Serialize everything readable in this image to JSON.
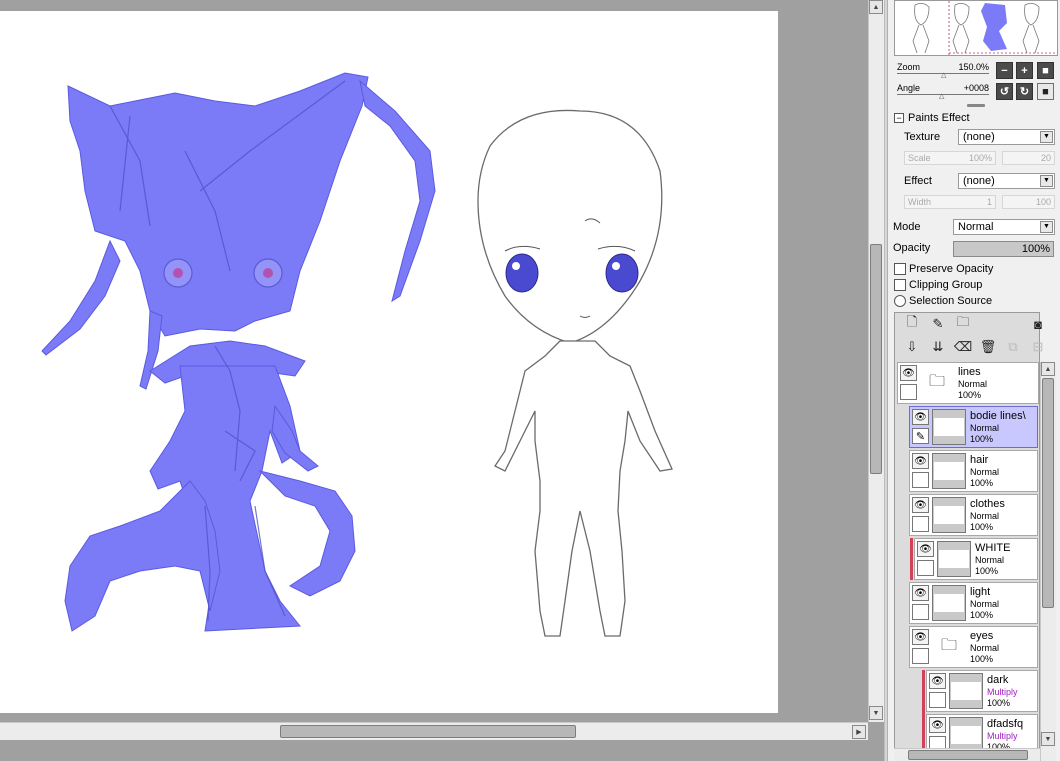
{
  "navigator": {
    "zoom_label": "Zoom",
    "zoom_value": "150.0%",
    "angle_label": "Angle",
    "angle_value": "+0008"
  },
  "paints_effect": {
    "title": "Paints Effect",
    "texture_label": "Texture",
    "texture_value": "(none)",
    "scale_label": "Scale",
    "scale_value": "100%",
    "scale_num": "20",
    "effect_label": "Effect",
    "effect_value": "(none)",
    "width_label": "Width",
    "width_value": "1",
    "width_num": "100"
  },
  "layer_props": {
    "mode_label": "Mode",
    "mode_value": "Normal",
    "opacity_label": "Opacity",
    "opacity_value": "100%",
    "preserve_opacity": "Preserve Opacity",
    "clipping_group": "Clipping Group",
    "selection_source": "Selection Source"
  },
  "layers": [
    {
      "name": "lines",
      "mode": "Normal",
      "opacity": "100%",
      "type": "folder"
    },
    {
      "name": "bodie lines\\",
      "mode": "Normal",
      "opacity": "100%",
      "type": "layer",
      "selected": true
    },
    {
      "name": "hair",
      "mode": "Normal",
      "opacity": "100%",
      "type": "layer"
    },
    {
      "name": "clothes",
      "mode": "Normal",
      "opacity": "100%",
      "type": "layer"
    },
    {
      "name": "WHITE",
      "mode": "Normal",
      "opacity": "100%",
      "type": "layer"
    },
    {
      "name": "light",
      "mode": "Normal",
      "opacity": "100%",
      "type": "layer"
    },
    {
      "name": "eyes",
      "mode": "Normal",
      "opacity": "100%",
      "type": "folder"
    },
    {
      "name": "dark",
      "mode": "Multiply",
      "opacity": "100%",
      "type": "layer"
    },
    {
      "name": "dfadsfq",
      "mode": "Multiply",
      "opacity": "100%",
      "type": "layer"
    }
  ],
  "colors": {
    "selection_fill": "#7b7bf8",
    "selected_layer": "#c8c8ff",
    "clip_bar": "#d2405a",
    "multiply_text": "#a020c0"
  }
}
